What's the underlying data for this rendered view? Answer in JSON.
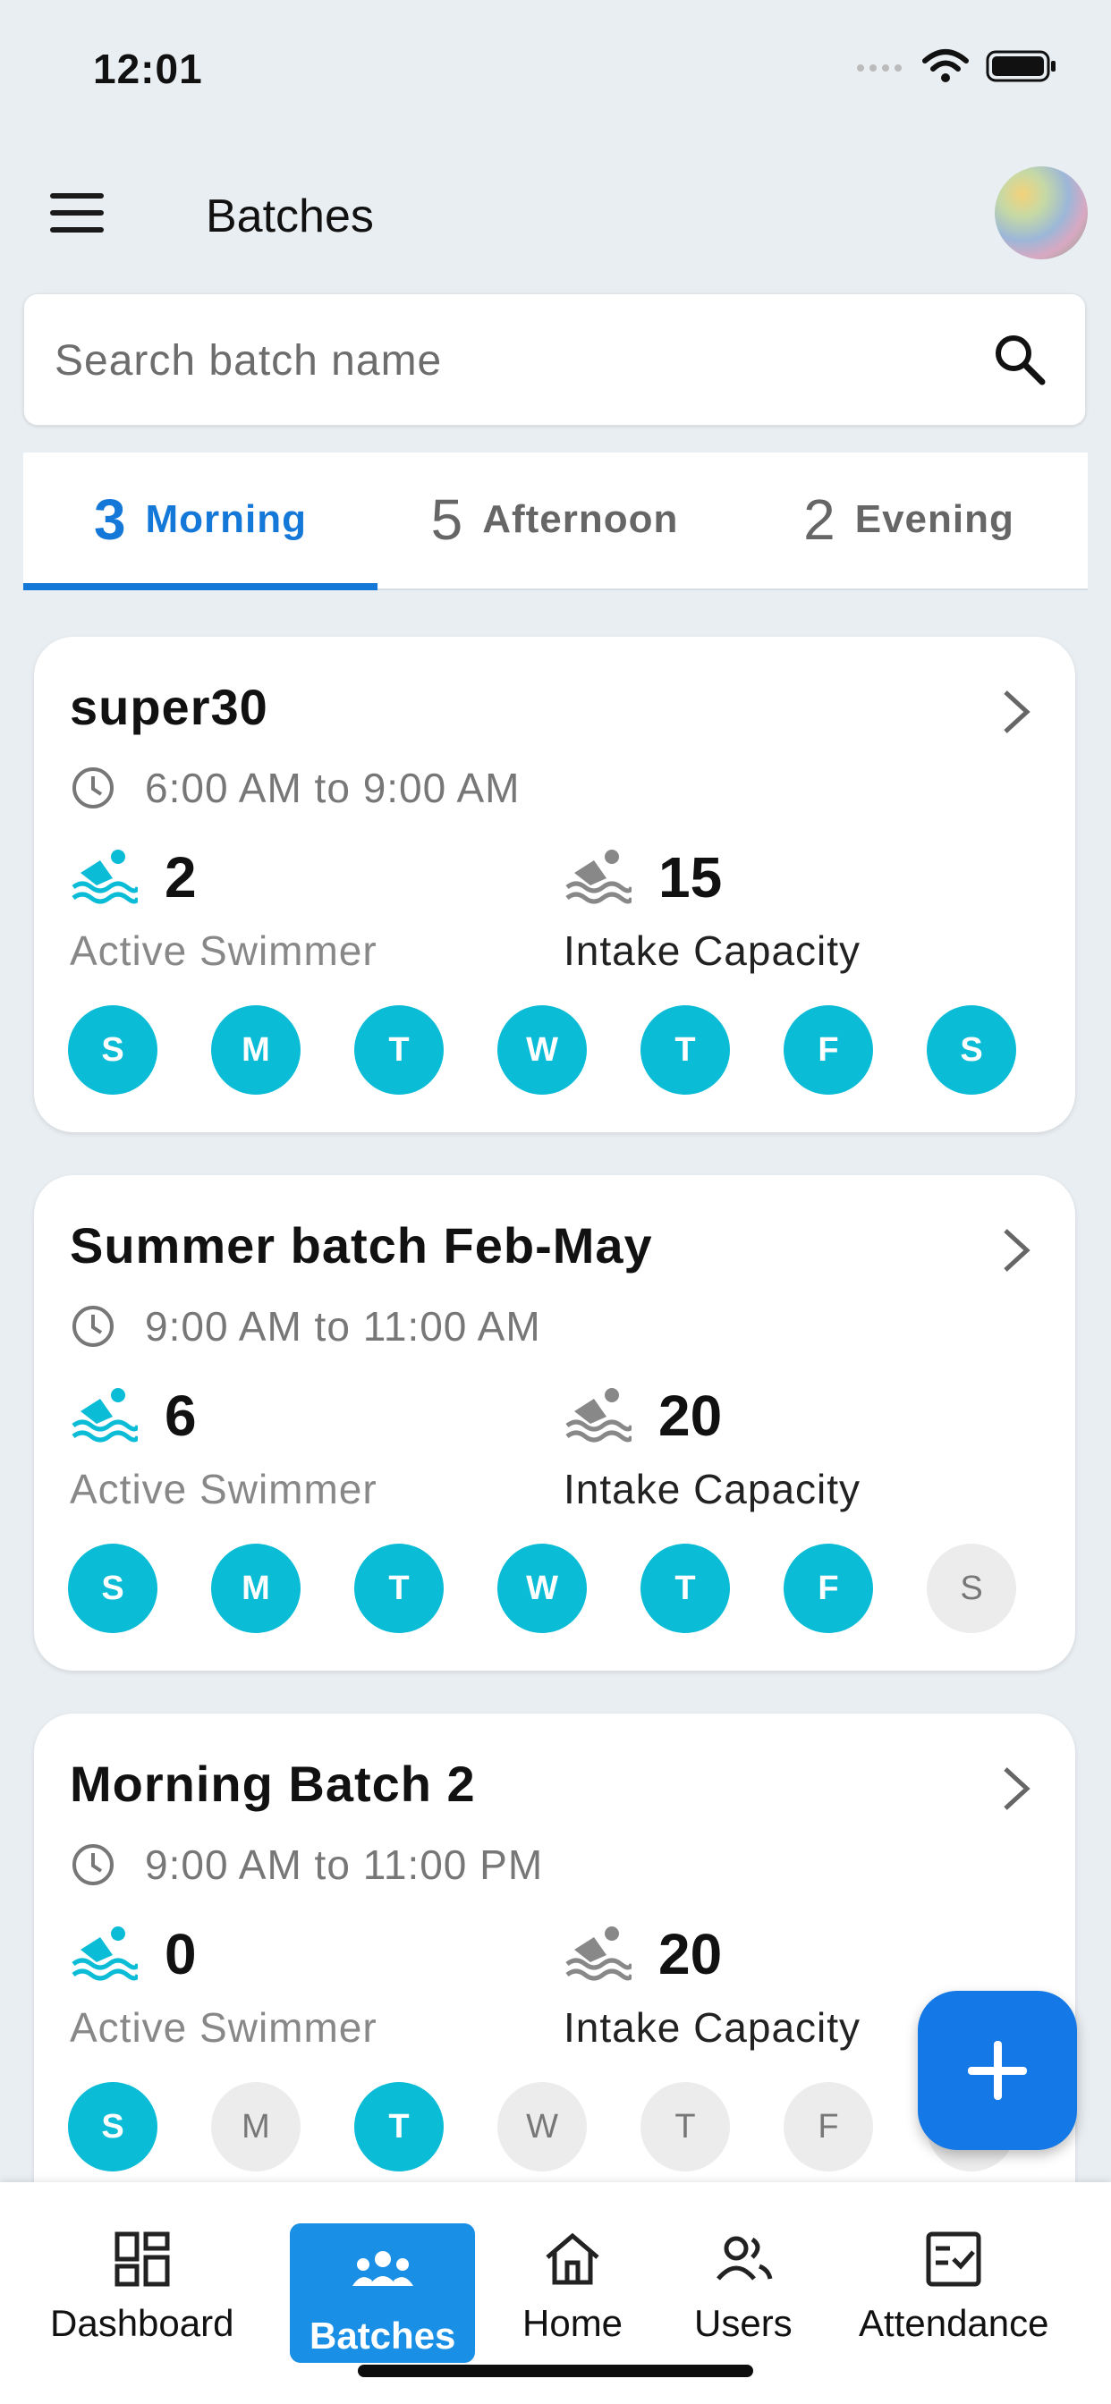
{
  "status_bar": {
    "time": "12:01"
  },
  "header": {
    "title": "Batches"
  },
  "search": {
    "placeholder": "Search batch name"
  },
  "tabs": [
    {
      "count": "3",
      "label": "Morning",
      "active": true
    },
    {
      "count": "5",
      "label": "Afternoon",
      "active": false
    },
    {
      "count": "2",
      "label": "Evening",
      "active": false
    }
  ],
  "batches": [
    {
      "name": "super30",
      "time": "6:00 AM to 9:00 AM",
      "active_count": "2",
      "active_label": "Active Swimmer",
      "capacity_count": "15",
      "capacity_label": "Intake Capacity",
      "days": [
        {
          "label": "S",
          "on": true
        },
        {
          "label": "M",
          "on": true
        },
        {
          "label": "T",
          "on": true
        },
        {
          "label": "W",
          "on": true
        },
        {
          "label": "T",
          "on": true
        },
        {
          "label": "F",
          "on": true
        },
        {
          "label": "S",
          "on": true
        }
      ]
    },
    {
      "name": "Summer batch Feb-May",
      "time": "9:00 AM to 11:00 AM",
      "active_count": "6",
      "active_label": "Active Swimmer",
      "capacity_count": "20",
      "capacity_label": "Intake Capacity",
      "days": [
        {
          "label": "S",
          "on": true
        },
        {
          "label": "M",
          "on": true
        },
        {
          "label": "T",
          "on": true
        },
        {
          "label": "W",
          "on": true
        },
        {
          "label": "T",
          "on": true
        },
        {
          "label": "F",
          "on": true
        },
        {
          "label": "S",
          "on": false
        }
      ]
    },
    {
      "name": "Morning Batch 2",
      "time": "9:00 AM to 11:00 PM",
      "active_count": "0",
      "active_label": "Active Swimmer",
      "capacity_count": "20",
      "capacity_label": "Intake Capacity",
      "days": [
        {
          "label": "S",
          "on": true
        },
        {
          "label": "M",
          "on": false
        },
        {
          "label": "T",
          "on": true
        },
        {
          "label": "W",
          "on": false
        },
        {
          "label": "T",
          "on": false
        },
        {
          "label": "F",
          "on": false
        },
        {
          "label": "S",
          "on": false
        }
      ]
    }
  ],
  "bottom_nav": [
    {
      "label": "Dashboard",
      "icon": "dashboard-icon",
      "active": false
    },
    {
      "label": "Batches",
      "icon": "groups-icon",
      "active": true
    },
    {
      "label": "Home",
      "icon": "home-icon",
      "active": false
    },
    {
      "label": "Users",
      "icon": "users-icon",
      "active": false
    },
    {
      "label": "Attendance",
      "icon": "attendance-icon",
      "active": false
    }
  ],
  "colors": {
    "accent": "#1478d9",
    "day_active": "#0bbcd6",
    "swim_icon": "#0bbcd6",
    "fab": "#1478e6"
  }
}
